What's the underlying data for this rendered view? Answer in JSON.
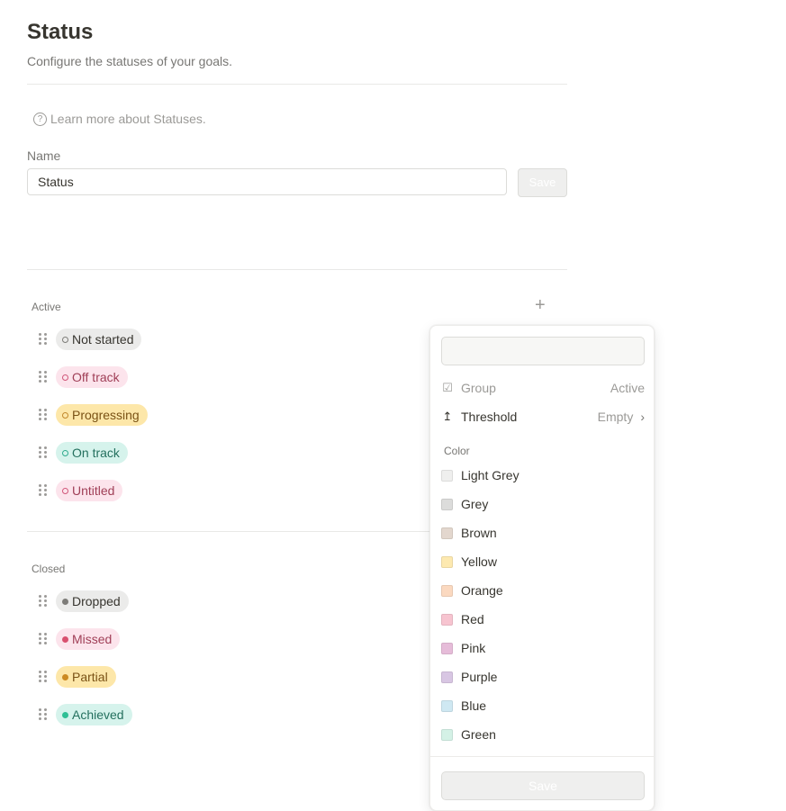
{
  "header": {
    "title": "Status",
    "subtitle": "Configure the statuses of your goals.",
    "learn_more": "Learn more about Statuses."
  },
  "name_field": {
    "label": "Name",
    "value": "Status",
    "save_label": "Save"
  },
  "active": {
    "label": "Active",
    "items": [
      {
        "label": "Not started",
        "bg": "#ebebea",
        "fg": "#37352f",
        "dot": "#7d7c78"
      },
      {
        "label": "Off track",
        "bg": "#fce4ec",
        "fg": "#a03f57",
        "dot": "#d1577a"
      },
      {
        "label": "Progressing",
        "bg": "#fde7a9",
        "fg": "#7a5215",
        "dot": "#c1872a"
      },
      {
        "label": "On track",
        "bg": "#d6f3ec",
        "fg": "#24705e",
        "dot": "#2fab8e"
      },
      {
        "label": "Untitled",
        "bg": "#fce4ec",
        "fg": "#a03f57",
        "dot": "#d1577a"
      }
    ]
  },
  "closed": {
    "label": "Closed",
    "items": [
      {
        "label": "Dropped",
        "bg": "#ebebea",
        "fg": "#37352f",
        "dot": "#7d7c78"
      },
      {
        "label": "Missed",
        "bg": "#fce4ec",
        "fg": "#a03f57",
        "dot": "#d9506f"
      },
      {
        "label": "Partial",
        "bg": "#fde7a9",
        "fg": "#7a5215",
        "dot": "#cc8a22"
      },
      {
        "label": "Achieved",
        "bg": "#d6f3ec",
        "fg": "#24705e",
        "dot": "#2fbf95"
      }
    ]
  },
  "popup": {
    "search_value": "",
    "group_label": "Group",
    "group_value": "Active",
    "threshold_label": "Threshold",
    "threshold_value": "Empty",
    "color_heading": "Color",
    "colors": [
      {
        "label": "Light Grey",
        "hex": "#efefee"
      },
      {
        "label": "Grey",
        "hex": "#dcdcdb"
      },
      {
        "label": "Brown",
        "hex": "#e3d7ce"
      },
      {
        "label": "Yellow",
        "hex": "#fde9b0"
      },
      {
        "label": "Orange",
        "hex": "#fbd9c0"
      },
      {
        "label": "Red",
        "hex": "#f7c4d0"
      },
      {
        "label": "Pink",
        "hex": "#e6bcd9"
      },
      {
        "label": "Purple",
        "hex": "#d8c6e3"
      },
      {
        "label": "Blue",
        "hex": "#cfe8f2"
      },
      {
        "label": "Green",
        "hex": "#d4f1e6"
      }
    ],
    "save_label": "Save"
  }
}
